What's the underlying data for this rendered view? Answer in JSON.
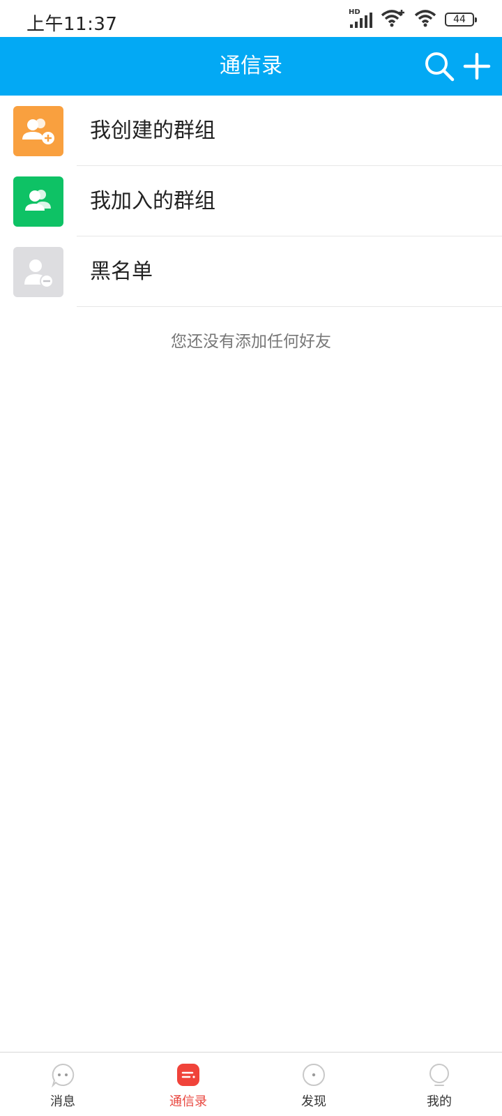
{
  "status_bar": {
    "time": "上午11:37",
    "network_badge": "HD",
    "battery_level": "44"
  },
  "header": {
    "title": "通信录",
    "search_icon": "search-icon",
    "add_icon": "plus-icon",
    "background_color": "#03a9f4"
  },
  "groups": {
    "items": [
      {
        "label": "我创建的群组",
        "icon": "add-group-icon",
        "color": "#f9a03f"
      },
      {
        "label": "我加入的群组",
        "icon": "group-icon",
        "color": "#0ec265"
      },
      {
        "label": "黑名单",
        "icon": "remove-user-icon",
        "color": "#dddde0"
      }
    ]
  },
  "empty_message": "您还没有添加任何好友",
  "tab_bar": {
    "tabs": [
      {
        "label": "消息",
        "icon": "chat-bubble-icon",
        "active": false
      },
      {
        "label": "通信录",
        "icon": "contacts-icon",
        "active": true
      },
      {
        "label": "发现",
        "icon": "discover-icon",
        "active": false
      },
      {
        "label": "我的",
        "icon": "profile-icon",
        "active": false
      }
    ],
    "active_color": "#e8463f"
  }
}
